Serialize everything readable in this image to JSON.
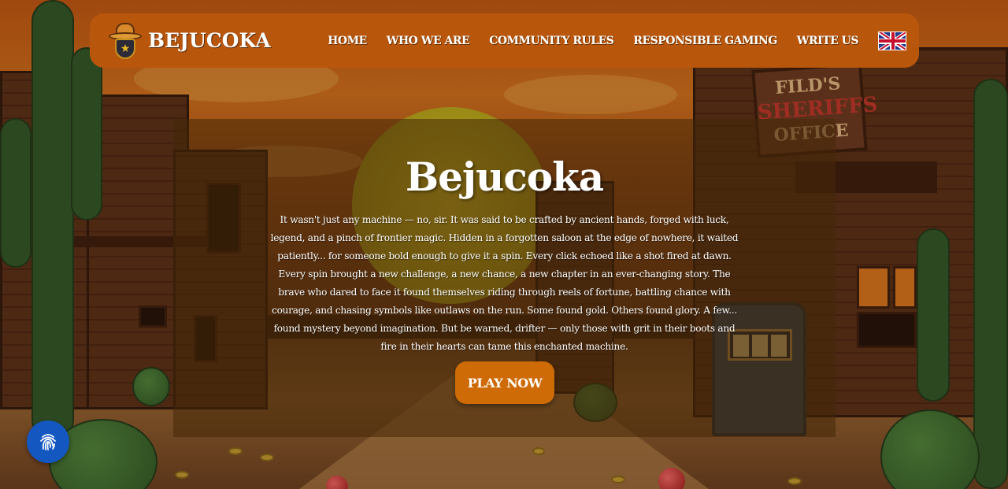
{
  "header": {
    "brand": "BEJUCOKA",
    "logo_icon": "sheriff-hat-badge-icon",
    "nav": [
      {
        "label": "HOME"
      },
      {
        "label": "WHO WE ARE"
      },
      {
        "label": "COMMUNITY RULES"
      },
      {
        "label": "RESPONSIBLE GAMING"
      },
      {
        "label": "WRITE US"
      }
    ],
    "language_icon": "uk-flag-icon"
  },
  "scene": {
    "sign_lines": [
      "FILD'S",
      "SHERIFFS",
      "OFFICE"
    ]
  },
  "hero": {
    "title": "Bejucoka",
    "text": "It wasn't just any machine — no, sir. It was said to be crafted by ancient hands, forged with luck, legend, and a pinch of frontier magic. Hidden in a forgotten saloon at the edge of nowhere, it waited patiently... for someone bold enough to give it a spin. Every click echoed like a shot fired at dawn. Every spin brought a new challenge, a new chance, a new chapter in an ever-changing story. The brave who dared to face it found themselves riding through reels of fortune, battling chance with courage, and chasing symbols like outlaws on the run. Some found gold. Others found glory. A few... found mystery beyond imagination. But be warned, drifter — only those with grit in their boots and fire in their hearts can tame this enchanted machine.",
    "cta_label": "PLAY NOW"
  },
  "widgets": {
    "fingerprint_icon": "fingerprint-icon"
  },
  "colors": {
    "header_bg": "#b8560b",
    "cta_bg": "#cf6b07",
    "fingerprint_bg": "#1557c0"
  }
}
